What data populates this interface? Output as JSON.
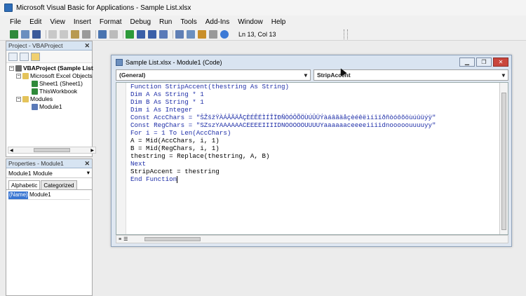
{
  "window": {
    "title": "Microsoft Visual Basic for Applications - Sample List.xlsx"
  },
  "menu": [
    "File",
    "Edit",
    "View",
    "Insert",
    "Format",
    "Debug",
    "Run",
    "Tools",
    "Add-Ins",
    "Window",
    "Help"
  ],
  "toolbar": {
    "position": "Ln 13, Col 13"
  },
  "project": {
    "title": "Project - VBAProject",
    "root": "VBAProject (Sample List",
    "folder1": "Microsoft Excel Objects",
    "sheet1": "Sheet1 (Sheet1)",
    "workbook": "ThisWorkbook",
    "folder2": "Modules",
    "module": "Module1"
  },
  "properties": {
    "title": "Properties - Module1",
    "selected": "Module1 Module",
    "tabs": [
      "Alphabetic",
      "Categorized"
    ],
    "row_name": "(Name)",
    "row_value": "Module1"
  },
  "code_window": {
    "title": "Sample List.xlsx - Module1 (Code)",
    "combo_left": "(General)",
    "combo_right": "StripAccent",
    "lines": [
      "Function StripAccent(thestring As String)",
      "Dim A As String * 1",
      "Dim B As String * 1",
      "Dim i As Integer",
      "Const AccChars = \"ŠŽšžŸÀÁÂÃÄÅÇÈÉÊËÌÍÎÏÐÑÒÓÔÕÖÙÚÛÜÝàáâãäåçèéêëìíîïðñòóôõöùúûüýÿ\"",
      "Const RegChars = \"SZszYAAAAAACEEEEIIIIDNOOOOOUUUUYaaaaaaceeeeiiiidnooooouuuuyy\"",
      "For i = 1 To Len(AccChars)",
      "A = Mid(AccChars, i, 1)",
      "B = Mid(RegChars, i, 1)",
      "thestring = Replace(thestring, A, B)",
      "Next",
      "StripAccent = thestring",
      "End Function"
    ]
  },
  "colors": {
    "keyword": "#1f2fa8",
    "panel_header": "#d7e4f2",
    "selection": "#3a76d2"
  }
}
